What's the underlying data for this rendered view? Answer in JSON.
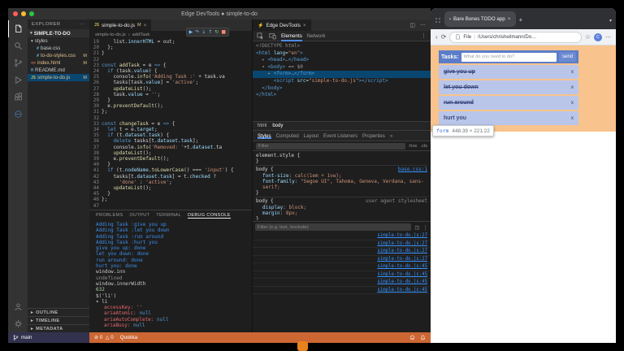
{
  "colors": {
    "status_orange": "#cc6633",
    "highlight_margin": "#f6b26b",
    "highlight_content": "#b9c6ea",
    "app_blue": "#5b7dc8",
    "link_blue": "#3794ff",
    "selection_blue": "#094771",
    "console_info_blue": "#3b8eea"
  },
  "icons": {
    "close": "×",
    "add": "+",
    "more": "⋯",
    "overflow": "···",
    "chevron": "›",
    "menu": "⋮",
    "split": "◫",
    "down": "▾",
    "right": "▸"
  },
  "vscode": {
    "title": "Edge DevTools ● simple-to-do",
    "explorer": {
      "header": "EXPLORER",
      "project": "SIMPLE-TO-DO",
      "files": [
        {
          "name": "styles",
          "kind": "folder",
          "depth": 0,
          "expanded": true
        },
        {
          "name": "base.css",
          "kind": "css",
          "depth": 1
        },
        {
          "name": "to-do-styles.css",
          "kind": "css",
          "depth": 1,
          "badge": "M"
        },
        {
          "name": "index.html",
          "kind": "html",
          "depth": 0,
          "badge": "M"
        },
        {
          "name": "README.md",
          "kind": "md",
          "depth": 0
        },
        {
          "name": "simple-to-do.js",
          "kind": "js",
          "depth": 0,
          "badge": "M",
          "active": true
        }
      ],
      "sections": [
        "OUTLINE",
        "TIMELINE",
        "METADATA"
      ]
    },
    "editor": {
      "tab": {
        "label": "simple-to-do.js",
        "badge": "M"
      },
      "breadcrumb": [
        "simple-to-do.js",
        "addTask"
      ],
      "code": [
        {
          "n": 19,
          "t": [
            [
              "p",
              "    list."
            ],
            [
              "v",
              "innerHTML"
            ],
            [
              "p",
              " = out;"
            ]
          ]
        },
        {
          "n": 20,
          "t": [
            [
              "p",
              "  };"
            ]
          ]
        },
        {
          "n": 21,
          "t": [
            [
              "p",
              "}"
            ]
          ]
        },
        {
          "n": 22,
          "t": []
        },
        {
          "n": 23,
          "t": [
            [
              "k",
              "const"
            ],
            [
              "p",
              " "
            ],
            [
              "f",
              "addTask"
            ],
            [
              "p",
              " = e "
            ],
            [
              "k",
              "=>"
            ],
            [
              "p",
              " {"
            ]
          ]
        },
        {
          "n": 24,
          "t": [
            [
              "p",
              "  "
            ],
            [
              "k",
              "if"
            ],
            [
              "p",
              " (task."
            ],
            [
              "v",
              "value"
            ],
            [
              "p",
              ") {"
            ]
          ]
        },
        {
          "n": 25,
          "t": [
            [
              "p",
              "    console."
            ],
            [
              "f",
              "info"
            ],
            [
              "p",
              "("
            ],
            [
              "s",
              "'Adding Task :'"
            ],
            [
              "p",
              " + task.va"
            ]
          ]
        },
        {
          "n": 26,
          "t": [
            [
              "p",
              "    tasks[task."
            ],
            [
              "v",
              "value"
            ],
            [
              "p",
              "] = "
            ],
            [
              "s",
              "'active'"
            ],
            [
              "p",
              ";"
            ]
          ]
        },
        {
          "n": 27,
          "t": [
            [
              "p",
              "    "
            ],
            [
              "f",
              "updateList"
            ],
            [
              "p",
              "();"
            ]
          ]
        },
        {
          "n": 28,
          "t": [
            [
              "p",
              "    task."
            ],
            [
              "v",
              "value"
            ],
            [
              "p",
              " = "
            ],
            [
              "s",
              "''"
            ],
            [
              "p",
              ";"
            ]
          ]
        },
        {
          "n": 29,
          "t": [
            [
              "p",
              "  }"
            ]
          ]
        },
        {
          "n": 30,
          "t": [
            [
              "p",
              "  e."
            ],
            [
              "f",
              "preventDefault"
            ],
            [
              "p",
              "();"
            ]
          ]
        },
        {
          "n": 31,
          "t": [
            [
              "p",
              "};"
            ]
          ]
        },
        {
          "n": 32,
          "t": []
        },
        {
          "n": 33,
          "t": [
            [
              "k",
              "const"
            ],
            [
              "p",
              " "
            ],
            [
              "f",
              "changeTask"
            ],
            [
              "p",
              " = e "
            ],
            [
              "k",
              "=>"
            ],
            [
              "p",
              " {"
            ]
          ]
        },
        {
          "n": 34,
          "t": [
            [
              "p",
              "  "
            ],
            [
              "k",
              "let"
            ],
            [
              "p",
              " t = e."
            ],
            [
              "v",
              "target"
            ],
            [
              "p",
              ";"
            ]
          ]
        },
        {
          "n": 35,
          "t": [
            [
              "p",
              "  "
            ],
            [
              "k",
              "if"
            ],
            [
              "p",
              " (t."
            ],
            [
              "v",
              "dataset"
            ],
            [
              "p",
              "."
            ],
            [
              "v",
              "task"
            ],
            [
              "p",
              ") {"
            ]
          ]
        },
        {
          "n": 36,
          "t": [
            [
              "p",
              "    "
            ],
            [
              "k",
              "delete"
            ],
            [
              "p",
              " tasks[t."
            ],
            [
              "v",
              "dataset"
            ],
            [
              "p",
              "."
            ],
            [
              "v",
              "task"
            ],
            [
              "p",
              "];"
            ]
          ]
        },
        {
          "n": 37,
          "t": [
            [
              "p",
              "    console."
            ],
            [
              "f",
              "info"
            ],
            [
              "p",
              "("
            ],
            [
              "s",
              "'Removed: '"
            ],
            [
              "p",
              "+t."
            ],
            [
              "v",
              "dataset"
            ],
            [
              "p",
              ".ta"
            ]
          ]
        },
        {
          "n": 38,
          "t": [
            [
              "p",
              "    "
            ],
            [
              "f",
              "updateList"
            ],
            [
              "p",
              "();"
            ]
          ]
        },
        {
          "n": 39,
          "t": [
            [
              "p",
              "    e."
            ],
            [
              "f",
              "preventDefault"
            ],
            [
              "p",
              "();"
            ]
          ]
        },
        {
          "n": 40,
          "t": [
            [
              "p",
              "  }"
            ]
          ]
        },
        {
          "n": 41,
          "t": [
            [
              "p",
              "  "
            ],
            [
              "k",
              "if"
            ],
            [
              "p",
              " (t."
            ],
            [
              "v",
              "nodeName"
            ],
            [
              "p",
              "."
            ],
            [
              "f",
              "toLowerCase"
            ],
            [
              "p",
              "() === "
            ],
            [
              "s",
              "'input'"
            ],
            [
              "p",
              ") {"
            ]
          ]
        },
        {
          "n": 42,
          "t": [
            [
              "p",
              "    tasks[t."
            ],
            [
              "v",
              "dataset"
            ],
            [
              "p",
              "."
            ],
            [
              "v",
              "task"
            ],
            [
              "p",
              "] = t."
            ],
            [
              "v",
              "checked"
            ],
            [
              "p",
              " ?"
            ]
          ]
        },
        {
          "n": 43,
          "t": [
            [
              "p",
              "      "
            ],
            [
              "s",
              "'done'"
            ],
            [
              "p",
              " : "
            ],
            [
              "s",
              "'active'"
            ],
            [
              "p",
              ";"
            ]
          ]
        },
        {
          "n": 44,
          "t": [
            [
              "p",
              "    "
            ],
            [
              "f",
              "updateList"
            ],
            [
              "p",
              "();"
            ]
          ]
        },
        {
          "n": 45,
          "t": [
            [
              "p",
              "  }"
            ]
          ]
        },
        {
          "n": 46,
          "t": [
            [
              "p",
              "};"
            ]
          ]
        },
        {
          "n": 47,
          "t": []
        }
      ]
    },
    "panel": {
      "tabs": [
        "PROBLEMS",
        "OUTPUT",
        "TERMINAL",
        "DEBUG CONSOLE"
      ],
      "active": "DEBUG CONSOLE",
      "lines": [
        {
          "c": "info",
          "t": "Adding Task :give you up"
        },
        {
          "c": "info",
          "t": "Adding Task :let you down"
        },
        {
          "c": "info",
          "t": "Adding Task :run around"
        },
        {
          "c": "info",
          "t": "Adding Task :hurt you"
        },
        {
          "c": "info",
          "t": "give you up: done"
        },
        {
          "c": "info",
          "t": "let you down: done"
        },
        {
          "c": "info",
          "t": "run around: done"
        },
        {
          "c": "info",
          "t": "hurt you: done"
        },
        {
          "c": "expr",
          "t": "window.inn"
        },
        {
          "c": "res",
          "t": "undefined"
        },
        {
          "c": "expr",
          "t": "window.innerWidth"
        },
        {
          "c": "num",
          "t": "632"
        },
        {
          "c": "expr",
          "t": "$('li')"
        },
        {
          "c": "node",
          "t": "li"
        },
        {
          "c": "prop",
          "k": "accessKey",
          "v": "''"
        },
        {
          "c": "prop",
          "k": "ariaAtomic",
          "v": "null"
        },
        {
          "c": "prop",
          "k": "ariaAutoComplete",
          "v": "null"
        },
        {
          "c": "prop",
          "k": "ariaBusy",
          "v": "null"
        }
      ]
    },
    "status": {
      "branch": "main",
      "errors": "0",
      "warnings": "0",
      "quokka": "Quokka"
    }
  },
  "devtools": {
    "tab": "Edge DevTools",
    "toolbar_tabs": [
      "Elements",
      "Network"
    ],
    "active_tab": "Elements",
    "dom": [
      {
        "sel": false,
        "t": [
          [
            "g",
            "<!DOCTYPE html>"
          ]
        ]
      },
      {
        "sel": false,
        "t": [
          [
            "t",
            "<html "
          ],
          [
            "a",
            "lang"
          ],
          [
            "p",
            "="
          ],
          [
            "q",
            "\"en\""
          ],
          [
            "t",
            ">"
          ]
        ]
      },
      {
        "sel": false,
        "t": [
          [
            "p",
            "  "
          ],
          [
            "g",
            "▸ "
          ],
          [
            "t",
            "<head>"
          ],
          [
            "g",
            "…"
          ],
          [
            "t",
            "</head>"
          ]
        ]
      },
      {
        "sel": false,
        "t": [
          [
            "p",
            "  "
          ],
          [
            "g",
            "▾ "
          ],
          [
            "t",
            "<body>"
          ],
          [
            "eq",
            " == $0"
          ]
        ]
      },
      {
        "sel": true,
        "t": [
          [
            "p",
            "    "
          ],
          [
            "g",
            "▸ "
          ],
          [
            "t",
            "<form>"
          ],
          [
            "g",
            "…"
          ],
          [
            "t",
            "</form>"
          ]
        ]
      },
      {
        "sel": false,
        "t": [
          [
            "p",
            "      "
          ],
          [
            "t",
            "<script "
          ],
          [
            "a",
            "src"
          ],
          [
            "p",
            "="
          ],
          [
            "q",
            "\"simple-to-do.js\""
          ],
          [
            "t",
            "></script>"
          ]
        ]
      },
      {
        "sel": false,
        "t": [
          [
            "p",
            "  "
          ],
          [
            "t",
            "</body>"
          ]
        ]
      },
      {
        "sel": false,
        "t": [
          [
            "t",
            "</html>"
          ]
        ]
      }
    ],
    "crumbs": [
      "html",
      "body"
    ],
    "panes": [
      "Styles",
      "Computed",
      "Layout",
      "Event Listeners",
      "Properties"
    ],
    "panes_more": "»",
    "filter_placeholder": "Filter",
    "toggles": [
      ":hov",
      ".cls"
    ],
    "rules": [
      {
        "selector": "element.style",
        "link": "",
        "props": []
      },
      {
        "selector": "body",
        "link": "base.css:1",
        "props": [
          [
            "font-size",
            "calc(1em + 1vw);"
          ],
          [
            "font-family",
            "\"Segoe UI\", Tahoma, Geneva, Verdana, sans-serif;"
          ]
        ]
      },
      {
        "selector": "body",
        "link": "user agent stylesheet",
        "props": [
          [
            "display",
            "block;"
          ],
          [
            "margin",
            "8px;"
          ]
        ]
      }
    ],
    "console": {
      "filter_placeholder": "Filter (e.g. text, !exclude)",
      "entries": [
        "simple-to-do.js:27",
        "simple-to-do.js:27",
        "simple-to-do.js:27",
        "simple-to-do.js:27",
        "simple-to-do.js:45",
        "simple-to-do.js:45",
        "simple-to-do.js:45",
        "simple-to-do.js:45"
      ]
    }
  },
  "browser": {
    "tab": {
      "title": "Bare Bones TODO app"
    },
    "address": {
      "scheme": "File",
      "path": "/Users/chrisheilmann/Do…"
    },
    "app": {
      "title": "Tasks:",
      "input_placeholder": "What do you need to do?",
      "send_label": "send",
      "delete_label": "x",
      "tasks": [
        {
          "text": "give you up",
          "done": true
        },
        {
          "text": "let you down",
          "done": true
        },
        {
          "text": "run around",
          "done": true
        },
        {
          "text": "hurt you",
          "done": false
        }
      ]
    },
    "tooltip": {
      "tag": "form",
      "dims": "448.39 × 221.22"
    }
  }
}
